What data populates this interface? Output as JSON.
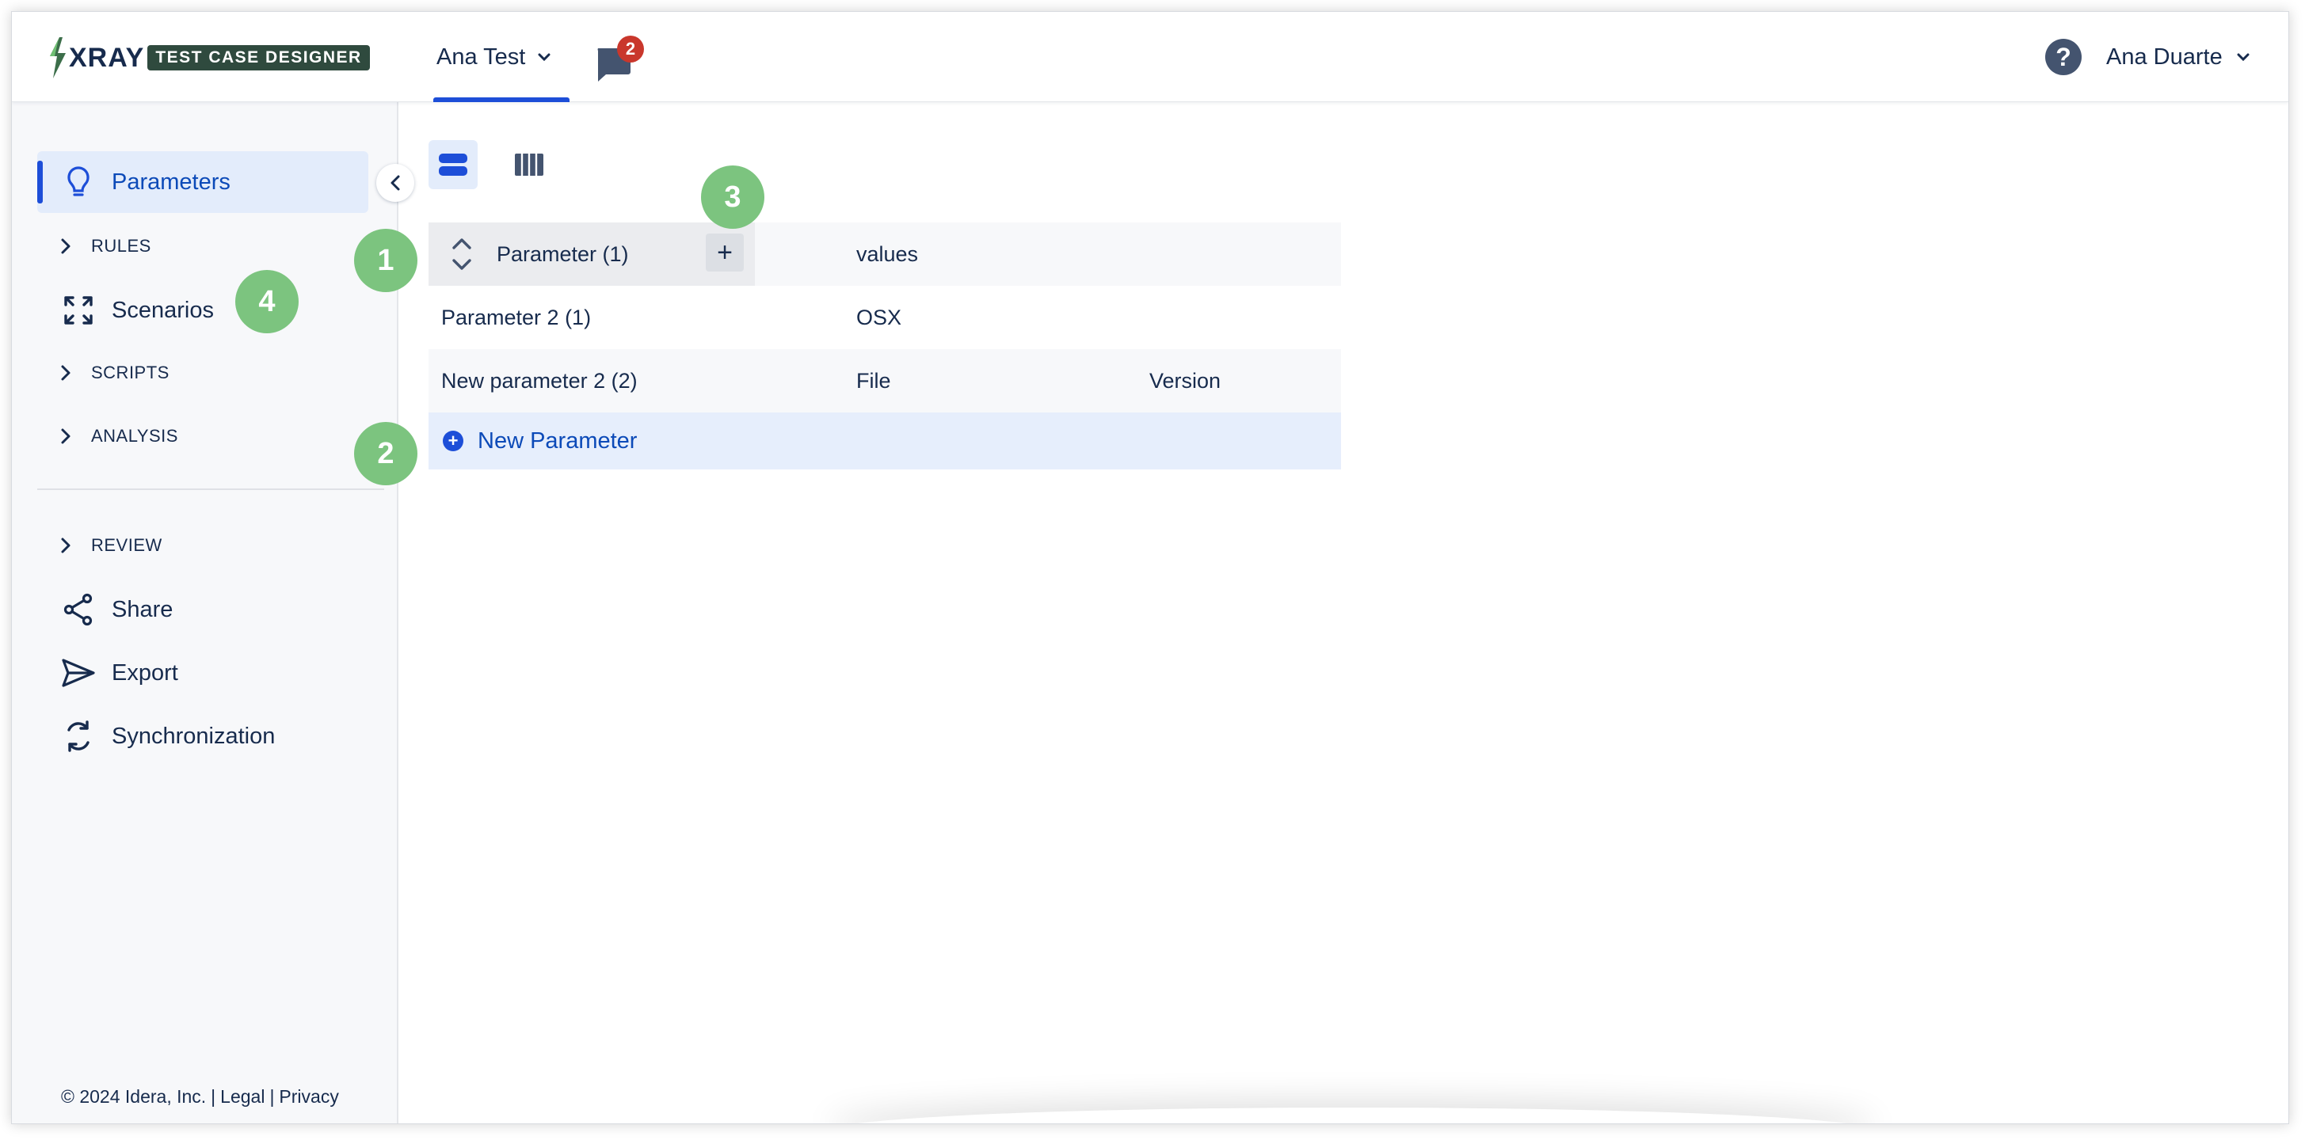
{
  "header": {
    "logo_text": "XRAY",
    "logo_badge": "TEST CASE DESIGNER",
    "project_name": "Ana Test",
    "notifications_count": "2",
    "help_icon": "?",
    "user_name": "Ana Duarte"
  },
  "sidebar": {
    "items": [
      {
        "label": "Parameters",
        "icon": "lightbulb-icon"
      },
      {
        "label": "RULES",
        "icon": "chevron-right-icon"
      },
      {
        "label": "Scenarios",
        "icon": "expand-arrows-icon"
      },
      {
        "label": "SCRIPTS",
        "icon": "chevron-right-icon"
      },
      {
        "label": "ANALYSIS",
        "icon": "chevron-right-icon"
      },
      {
        "label": "REVIEW",
        "icon": "chevron-right-icon"
      },
      {
        "label": "Share",
        "icon": "share-icon"
      },
      {
        "label": "Export",
        "icon": "send-icon"
      },
      {
        "label": "Synchronization",
        "icon": "sync-icon"
      }
    ],
    "footer": {
      "copyright": "© 2024 Idera, Inc.",
      "sep1": "|",
      "legal": "Legal",
      "sep2": "|",
      "privacy": "Privacy"
    }
  },
  "main": {
    "table": {
      "header": {
        "name": "Parameter (1)",
        "values_label": "values",
        "add_icon": "+"
      },
      "rows": [
        {
          "name": "Parameter 2 (1)",
          "values": [
            "OSX",
            ""
          ]
        },
        {
          "name": "New parameter 2 (2)",
          "values": [
            "File",
            "Version"
          ]
        }
      ],
      "new_parameter_label": "New Parameter",
      "new_parameter_icon": "+"
    }
  },
  "callouts": [
    "1",
    "2",
    "3",
    "4"
  ],
  "colors": {
    "accent": "#1d4ed8",
    "active_bg": "#e3ecfb",
    "callout": "#7cc47f",
    "badge": "#c9372c"
  }
}
